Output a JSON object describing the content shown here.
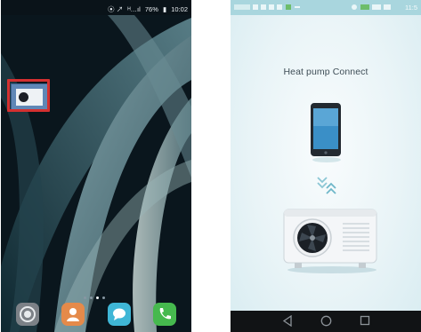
{
  "left_phone": {
    "status_bar": {
      "left_icons": "⦿ ↗",
      "signal": "ᴴ…ıl",
      "battery_percent": "76%",
      "time": "10:02"
    },
    "home_pages": {
      "count": 4,
      "current_index": 2
    },
    "highlighted_app_icon": "heat-pump-app-icon",
    "highlight_color": "#d43030",
    "dock": [
      "settings-icon",
      "contacts-icon",
      "messages-icon",
      "phone-icon"
    ]
  },
  "right_phone": {
    "status_bar": {
      "time": "11:5"
    },
    "app_title": "Heat pump Connect",
    "illustration": [
      "smartphone-icon",
      "sync-chevrons-icon",
      "heat-pump-unit-icon"
    ],
    "nav_bar": [
      "back-icon",
      "home-icon",
      "recents-icon"
    ],
    "accent_color": "#7fc6d6"
  }
}
